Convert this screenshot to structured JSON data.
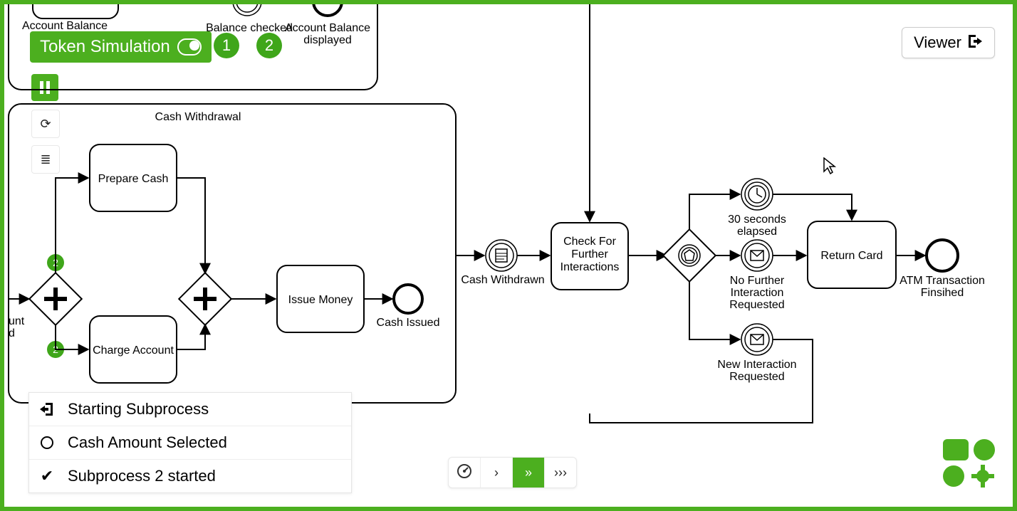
{
  "toolbar": {
    "token_simulation_label": "Token Simulation",
    "badge1": "1",
    "badge2": "2",
    "viewer_label": "Viewer"
  },
  "subprocess_top": {
    "label_balance_checked": "Balance checked",
    "label_account_balance_displayed_l1": "Account Balance",
    "label_account_balance_displayed_l2": "displayed",
    "label_account_balance_partial": "Account Balance"
  },
  "subprocess_cash": {
    "title": "Cash Withdrawal",
    "prepare_cash": "Prepare Cash",
    "charge_account": "Charge Account",
    "issue_money": "Issue Money",
    "cash_issued": "Cash Issued",
    "partial_left_l1": "unt",
    "partial_left_l2": "d",
    "token_top": "2",
    "token_bottom": "2"
  },
  "main_flow": {
    "cash_withdrawn": "Cash Withdrawn",
    "check_further_l1": "Check For",
    "check_further_l2": "Further",
    "check_further_l3": "Interactions",
    "thirty_sec_l1": "30 seconds",
    "thirty_sec_l2": "elapsed",
    "no_further_l1": "No Further",
    "no_further_l2": "Interaction",
    "no_further_l3": "Requested",
    "new_interaction_l1": "New Interaction",
    "new_interaction_l2": "Requested",
    "return_card": "Return Card",
    "atm_finished_l1": "ATM Transaction",
    "atm_finished_l2": "Finsihed"
  },
  "log": {
    "row1": "Starting Subprocess",
    "row2": "Cash Amount Selected",
    "row3": "Subprocess 2 started"
  },
  "chart_data": {
    "type": "bpmn",
    "subprocesses": [
      {
        "name": "Account Balance (partial view)",
        "events": [
          "Balance checked (intermediate)",
          "Account Balance displayed (end)"
        ]
      },
      {
        "name": "Cash Withdrawal",
        "elements": [
          {
            "id": "gw_split",
            "type": "parallelGateway"
          },
          {
            "id": "prepare_cash",
            "type": "task",
            "name": "Prepare Cash"
          },
          {
            "id": "charge_account",
            "type": "task",
            "name": "Charge Account"
          },
          {
            "id": "gw_join",
            "type": "parallelGateway"
          },
          {
            "id": "issue_money",
            "type": "task",
            "name": "Issue Money"
          },
          {
            "id": "cash_issued",
            "type": "endEvent",
            "name": "Cash Issued"
          }
        ],
        "flows": [
          [
            "gw_split",
            "prepare_cash"
          ],
          [
            "gw_split",
            "charge_account"
          ],
          [
            "prepare_cash",
            "gw_join"
          ],
          [
            "charge_account",
            "gw_join"
          ],
          [
            "gw_join",
            "issue_money"
          ],
          [
            "issue_money",
            "cash_issued"
          ]
        ],
        "active_tokens": {
          "gw_split->prepare_cash": 2,
          "gw_split->charge_account": 2
        }
      }
    ],
    "main": {
      "elements": [
        {
          "id": "cash_withdrawn",
          "type": "intermediateEvent",
          "name": "Cash Withdrawn",
          "icon": "document"
        },
        {
          "id": "check_further",
          "type": "task",
          "name": "Check For Further Interactions"
        },
        {
          "id": "gw_event",
          "type": "eventBasedGateway"
        },
        {
          "id": "timer_30s",
          "type": "intermediateEvent",
          "name": "30 seconds elapsed",
          "icon": "timer"
        },
        {
          "id": "msg_no_further",
          "type": "intermediateEvent",
          "name": "No Further Interaction Requested",
          "icon": "message"
        },
        {
          "id": "msg_new",
          "type": "intermediateEvent",
          "name": "New Interaction Requested",
          "icon": "message"
        },
        {
          "id": "return_card",
          "type": "task",
          "name": "Return Card"
        },
        {
          "id": "atm_finished",
          "type": "endEvent",
          "name": "ATM Transaction Finsihed"
        }
      ],
      "flows": [
        [
          "(incoming top)",
          "check_further"
        ],
        [
          "cash_withdrawn",
          "check_further"
        ],
        [
          "check_further",
          "gw_event"
        ],
        [
          "gw_event",
          "timer_30s"
        ],
        [
          "gw_event",
          "msg_no_further"
        ],
        [
          "gw_event",
          "msg_new"
        ],
        [
          "timer_30s",
          "return_card"
        ],
        [
          "msg_no_further",
          "return_card"
        ],
        [
          "msg_new",
          "(loop back to upstream)"
        ],
        [
          "return_card",
          "atm_finished"
        ]
      ]
    }
  }
}
